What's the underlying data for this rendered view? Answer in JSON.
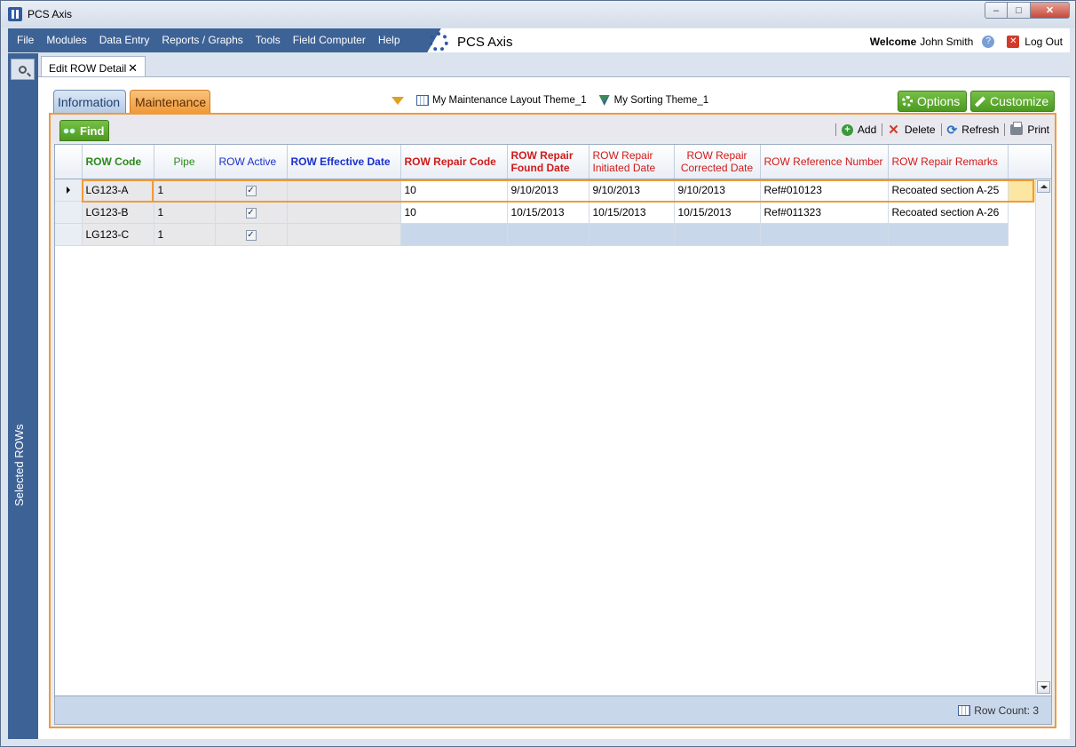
{
  "window": {
    "title": "PCS Axis"
  },
  "menu": {
    "items": [
      "File",
      "Modules",
      "Data Entry",
      "Reports / Graphs",
      "Tools",
      "Field Computer",
      "Help"
    ],
    "brand": "PCS Axis",
    "welcome_label": "Welcome",
    "user_name": "John Smith",
    "logout_label": "Log Out"
  },
  "sidebar": {
    "label": "Selected ROWs"
  },
  "doc_tab": {
    "label": "Edit ROW Detail",
    "close": "✕"
  },
  "tabs": {
    "information": "Information",
    "maintenance": "Maintenance"
  },
  "themes": {
    "layout": "My Maintenance Layout Theme_1",
    "sorting": "My Sorting Theme_1"
  },
  "buttons": {
    "options": "Options",
    "customize": "Customize",
    "find": "Find"
  },
  "actions": {
    "add": "Add",
    "delete": "Delete",
    "refresh": "Refresh",
    "print": "Print"
  },
  "grid": {
    "columns": [
      {
        "label": "ROW Code"
      },
      {
        "label": "Pipe"
      },
      {
        "label": "ROW Active"
      },
      {
        "label": "ROW Effective Date"
      },
      {
        "label": "ROW Repair Code"
      },
      {
        "label": "ROW Repair Found Date"
      },
      {
        "label": "ROW Repair Initiated Date"
      },
      {
        "label": "ROW Repair Corrected Date"
      },
      {
        "label": "ROW Reference Number"
      },
      {
        "label": "ROW Repair Remarks"
      }
    ],
    "rows": [
      {
        "code": "LG123-A",
        "pipe": "1",
        "active": "✓",
        "effective": "",
        "repair_code": "10",
        "found": "9/10/2013",
        "initiated": "9/10/2013",
        "corrected": "9/10/2013",
        "ref": "Ref#010123",
        "remarks": "Recoated section A-25"
      },
      {
        "code": "LG123-B",
        "pipe": "1",
        "active": "✓",
        "effective": "",
        "repair_code": "10",
        "found": "10/15/2013",
        "initiated": "10/15/2013",
        "corrected": "10/15/2013",
        "ref": "Ref#011323",
        "remarks": "Recoated section A-26"
      },
      {
        "code": "LG123-C",
        "pipe": "1",
        "active": "✓",
        "effective": "",
        "repair_code": "",
        "found": "",
        "initiated": "",
        "corrected": "",
        "ref": "",
        "remarks": ""
      }
    ]
  },
  "footer": {
    "row_count_label": "Row Count:",
    "row_count": "3"
  }
}
